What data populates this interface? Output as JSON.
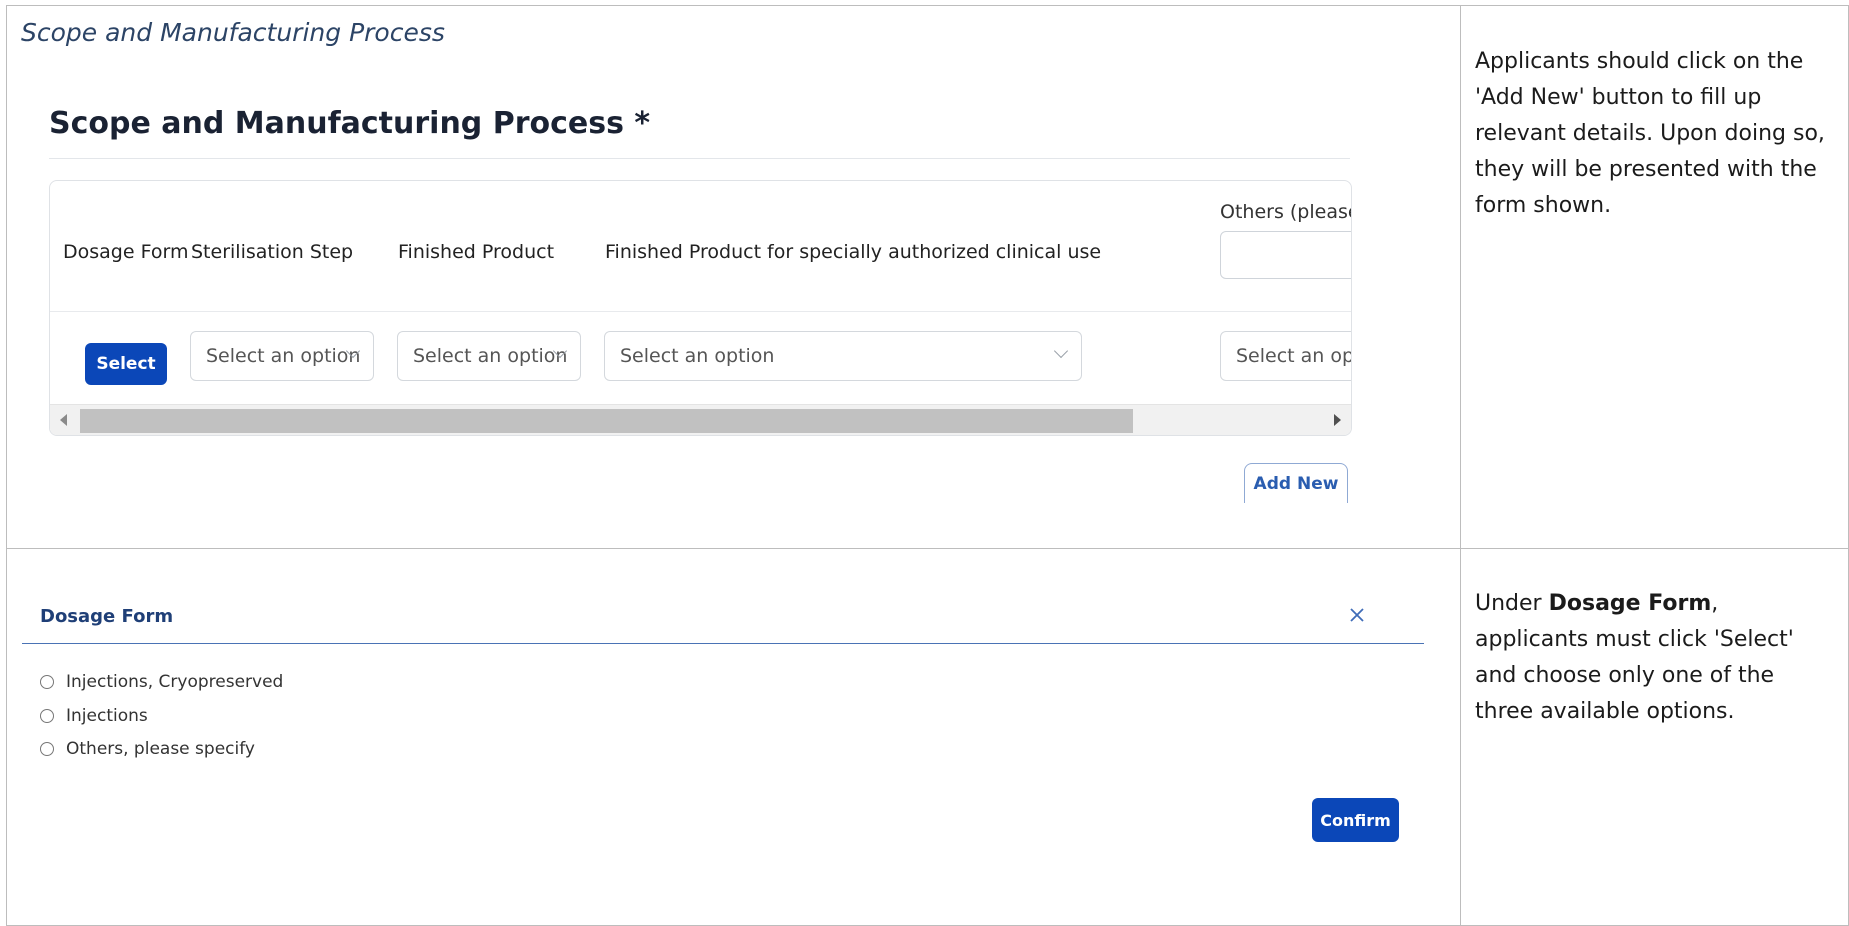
{
  "top_section": {
    "caption": "Scope and Manufacturing Process",
    "form_title": "Scope and Manufacturing Process *",
    "columns": {
      "dosage_form": "Dosage Form",
      "sterilisation_step": "Sterilisation Step",
      "finished_product": "Finished Product",
      "finished_product_special": "Finished Product for specially authorized clinical use",
      "others": "Others (please"
    },
    "select_button": "Select",
    "dropdowns": {
      "sterilisation_step": "Select an option",
      "finished_product": "Select an option",
      "finished_product_special": "Select an option",
      "others": "Select an op"
    },
    "add_new_button": "Add New",
    "note": "Applicants should click on the 'Add New' button to fill up relevant details. Upon doing so, they will be presented with the form shown."
  },
  "bottom_section": {
    "modal_title": "Dosage Form",
    "options": [
      "Injections, Cryopreserved",
      "Injections",
      "Others, please specify"
    ],
    "confirm_button": "Confirm",
    "note": {
      "prefix": "Under ",
      "bold": "Dosage Form",
      "suffix": ", applicants must click 'Select' and choose only one of the three available options."
    }
  },
  "colors": {
    "primary_button": "#0b47b8",
    "link_blue": "#2a5db0",
    "modal_title": "#1f3f77"
  }
}
